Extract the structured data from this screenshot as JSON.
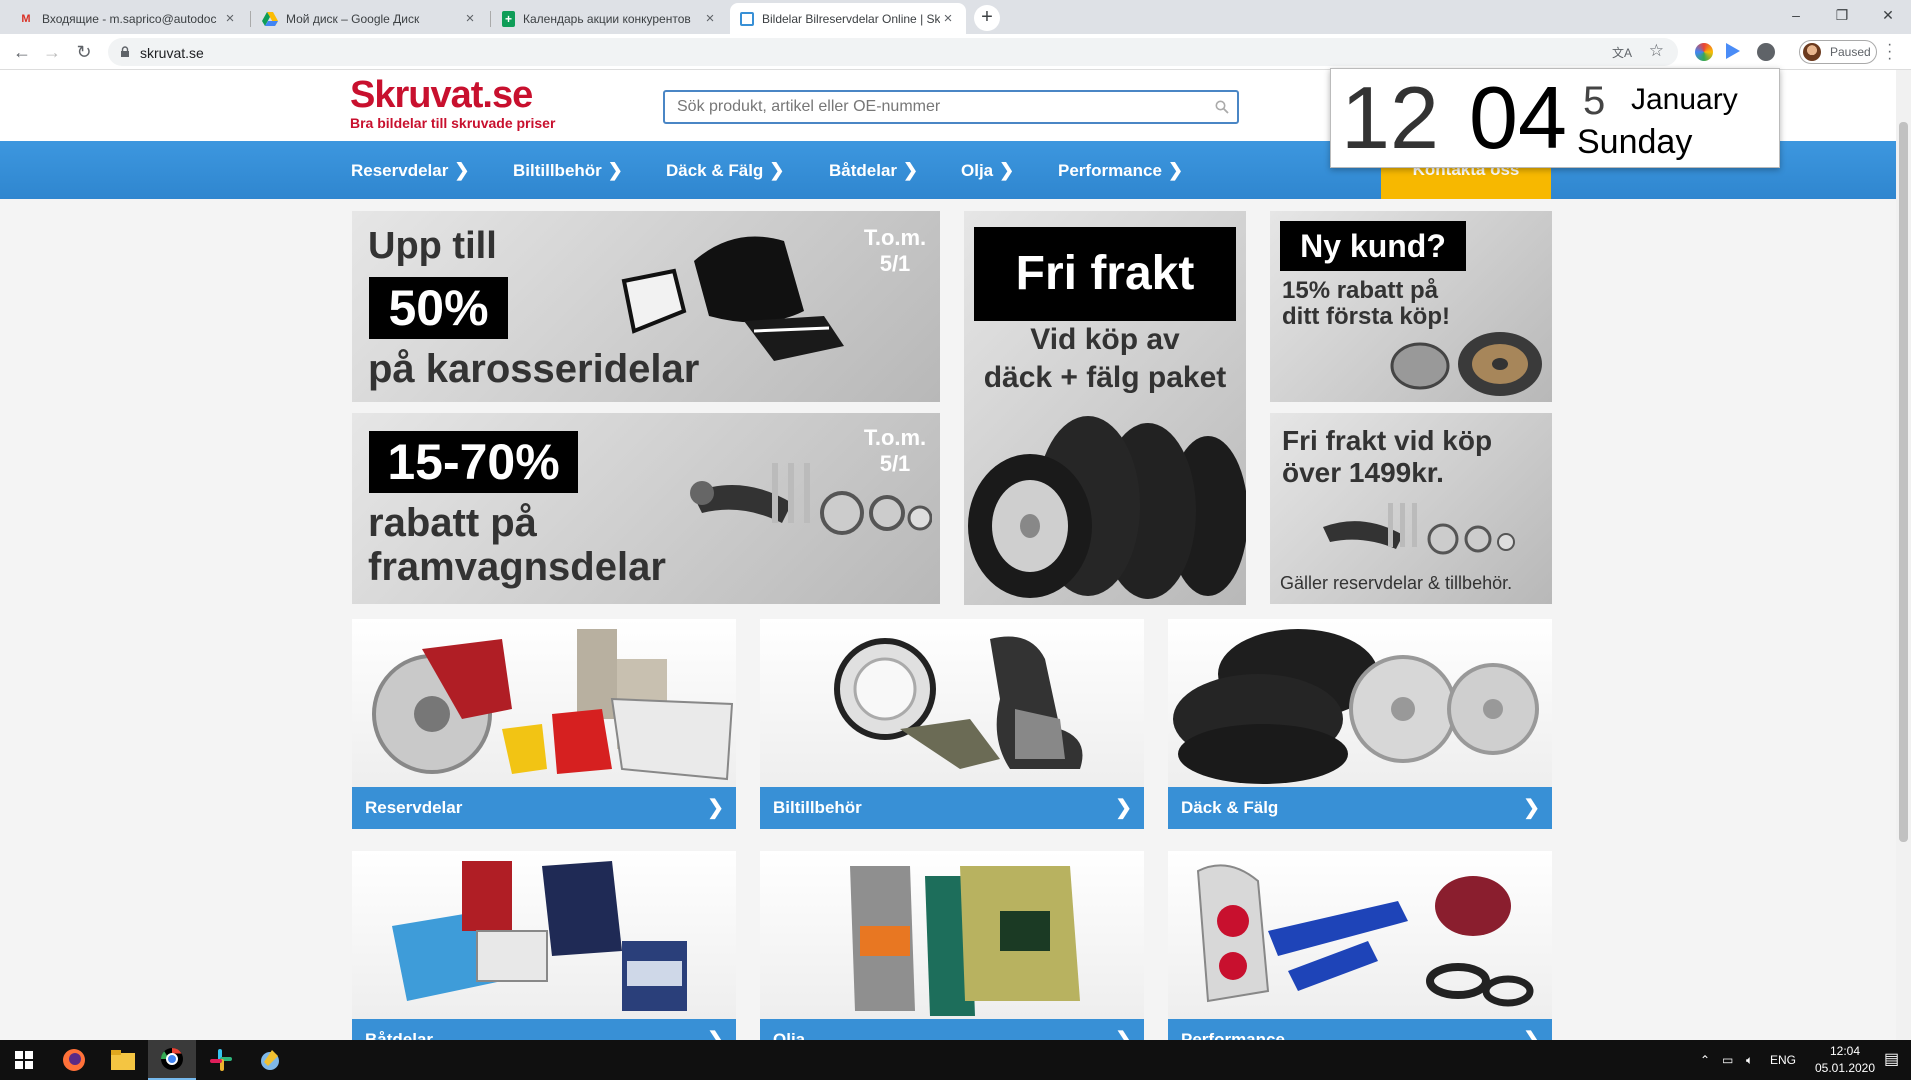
{
  "browser": {
    "tabs": [
      {
        "title": "Входящие - m.saprico@autodoc",
        "favicon": "gmail-icon",
        "active": false
      },
      {
        "title": "Мой диск – Google Диск",
        "favicon": "google-drive-icon",
        "active": false
      },
      {
        "title": "Календарь акции конкурентов",
        "favicon": "google-sheets-icon",
        "active": false
      },
      {
        "title": "Bildelar Bilreservdelar Online | Sk",
        "favicon": "skruvat-favicon",
        "active": true
      }
    ],
    "url": "skruvat.se",
    "profile_status": "Paused"
  },
  "site": {
    "logo_name": "Skruvat.se",
    "logo_tagline": "Bra bildelar till skruvade priser",
    "search_placeholder": "Sök produkt, artikel eller OE-nummer",
    "nav": [
      "Reservdelar",
      "Biltillbehör",
      "Däck & Fälg",
      "Båtdelar",
      "Olja",
      "Performance"
    ],
    "contact": "Kontakta oss"
  },
  "banners": {
    "b1": {
      "line1": "Upp till",
      "box": "50%",
      "line2": "på karosseridelar",
      "tom1": "T.o.m.",
      "tom2": "5/1"
    },
    "b2": {
      "box": "15-70%",
      "line1": "rabatt på",
      "line2": "framvagnsdelar",
      "tom1": "T.o.m.",
      "tom2": "5/1"
    },
    "b3": {
      "box": "Fri frakt",
      "line1": "Vid köp av",
      "line2": "däck + fälg paket"
    },
    "b4": {
      "box": "Ny kund?",
      "line1": "15% rabatt på",
      "line2": "ditt första köp!"
    },
    "b5": {
      "line1": "Fri frakt vid köp",
      "line2": "över 1499kr.",
      "footer": "Gäller reservdelar & tillbehör."
    }
  },
  "categories": [
    {
      "label": "Reservdelar"
    },
    {
      "label": "Biltillbehör"
    },
    {
      "label": "Däck & Fälg"
    },
    {
      "label": "Båtdelar"
    },
    {
      "label": "Olja"
    },
    {
      "label": "Performance"
    }
  ],
  "clock": {
    "hour": "12",
    "minute": "04",
    "day": "5",
    "month": "January",
    "weekday": "Sunday"
  },
  "taskbar": {
    "lang": "ENG",
    "time": "12:04",
    "date": "05.01.2020"
  },
  "colors": {
    "brand_red": "#c8102e",
    "nav_blue": "#3890d6",
    "contact_yellow": "#f7b800"
  }
}
